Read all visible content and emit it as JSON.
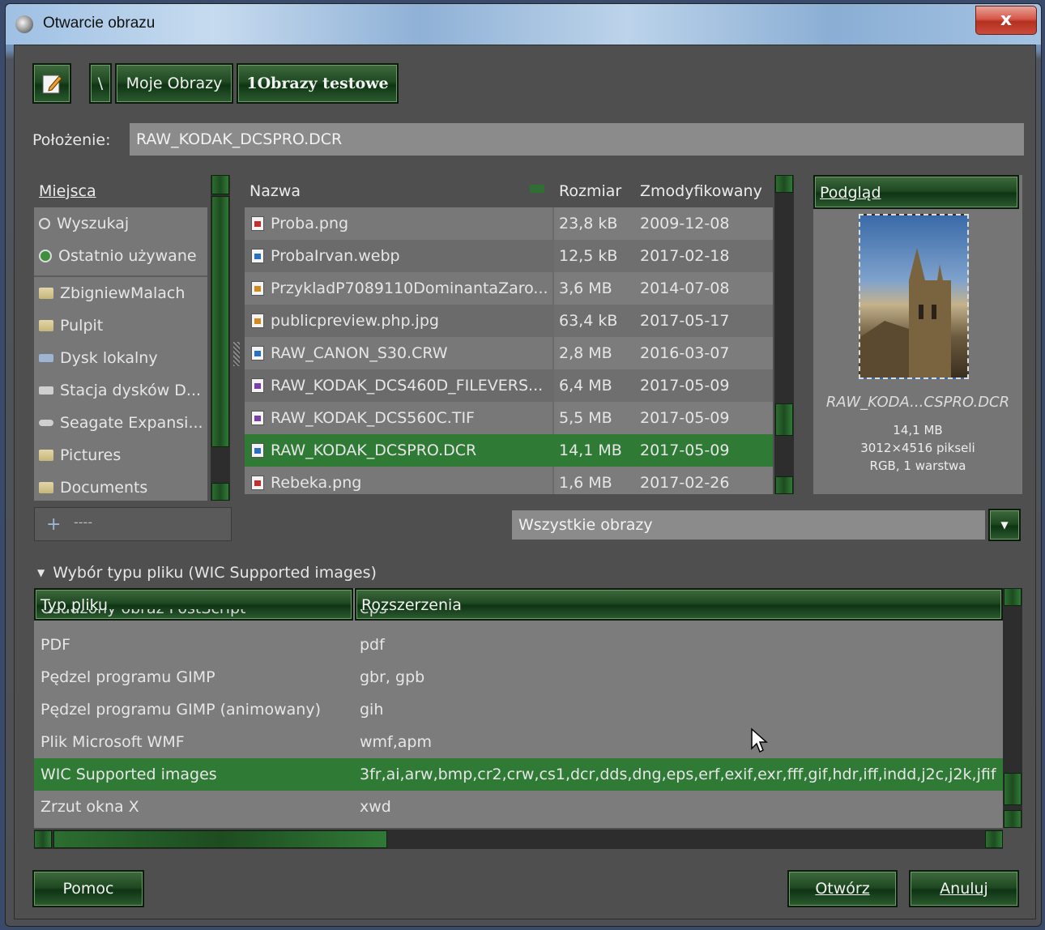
{
  "window": {
    "title": "Otwarcie obrazu",
    "close_label": "x"
  },
  "path_bar": {
    "edit_icon": "pencil-edit-icon",
    "root_label": "\\",
    "crumbs": [
      "Moje Obrazy",
      "1Obrazy testowe"
    ]
  },
  "location": {
    "label": "Położenie:",
    "value": "RAW_KODAK_DCSPRO.DCR"
  },
  "places": {
    "header": "Miejsca",
    "items": [
      {
        "label": "Wyszukaj",
        "icon": "search-icon"
      },
      {
        "label": "Ostatnio używane",
        "icon": "recent-icon"
      },
      {
        "label": "ZbigniewMalach",
        "icon": "folder-icon"
      },
      {
        "label": "Pulpit",
        "icon": "folder-icon"
      },
      {
        "label": "Dysk lokalny",
        "icon": "drive-icon"
      },
      {
        "label": "Stacja dysków D...",
        "icon": "drive-icon"
      },
      {
        "label": "Seagate Expansi...",
        "icon": "drive-icon"
      },
      {
        "label": "Pictures",
        "icon": "folder-icon"
      },
      {
        "label": "Documents",
        "icon": "folder-icon"
      }
    ],
    "add_icon": "add-icon",
    "remove_icon": "remove-icon"
  },
  "files": {
    "columns": [
      "Nazwa",
      "Rozmiar",
      "Zmodyfikowany"
    ],
    "rows": [
      {
        "name": "Proba.png",
        "size": "23,8 kB",
        "date": "2009-12-08",
        "icon": "red"
      },
      {
        "name": "ProbaIrvan.webp",
        "size": "12,5 kB",
        "date": "2017-02-18",
        "icon": "blue"
      },
      {
        "name": "PrzykladP7089110DominantaZaro...",
        "size": "3,6 MB",
        "date": "2014-07-08",
        "icon": "org"
      },
      {
        "name": "publicpreview.php.jpg",
        "size": "63,4 kB",
        "date": "2017-05-17",
        "icon": "org"
      },
      {
        "name": "RAW_CANON_S30.CRW",
        "size": "2,8 MB",
        "date": "2016-03-07",
        "icon": "blue"
      },
      {
        "name": "RAW_KODAK_DCS460D_FILEVERS...",
        "size": "6,4 MB",
        "date": "2017-05-09",
        "icon": "pur"
      },
      {
        "name": "RAW_KODAK_DCS560C.TIF",
        "size": "5,5 MB",
        "date": "2017-05-09",
        "icon": "pur"
      },
      {
        "name": "RAW_KODAK_DCSPRO.DCR",
        "size": "14,1 MB",
        "date": "2017-05-09",
        "icon": "blue",
        "selected": true
      },
      {
        "name": "Rebeka.png",
        "size": "1,6 MB",
        "date": "2017-02-26",
        "icon": "red"
      }
    ]
  },
  "preview": {
    "header": "Podgląd",
    "filename": "RAW_KODA...CSPRO.DCR",
    "size": "14,1 MB",
    "dimensions": "3012×4516 pikseli",
    "mode": "RGB, 1 warstwa"
  },
  "filter": {
    "value": "Wszystkie obrazy"
  },
  "filetype": {
    "expander": "Wybór typu pliku (WIC Supported images)",
    "columns": [
      "Typ pliku",
      "Rozszerzenia"
    ],
    "clipped_row": {
      "type": "Osadzony obraz PostScript",
      "ext": "eps"
    },
    "rows": [
      {
        "type": "PDF",
        "ext": "pdf"
      },
      {
        "type": "Pędzel programu GIMP",
        "ext": "gbr, gpb"
      },
      {
        "type": "Pędzel programu GIMP (animowany)",
        "ext": "gih"
      },
      {
        "type": "Plik Microsoft WMF",
        "ext": "wmf,apm"
      },
      {
        "type": "WIC Supported images",
        "ext": "3fr,ai,arw,bmp,cr2,crw,cs1,dcr,dds,dng,eps,erf,exif,exr,fff,gif,hdr,iff,indd,j2c,j2k,jfif",
        "selected": true
      },
      {
        "type": "Zrzut okna X",
        "ext": "xwd"
      }
    ]
  },
  "buttons": {
    "help": "Pomoc",
    "open": "Otwórz",
    "cancel": "Anuluj"
  }
}
